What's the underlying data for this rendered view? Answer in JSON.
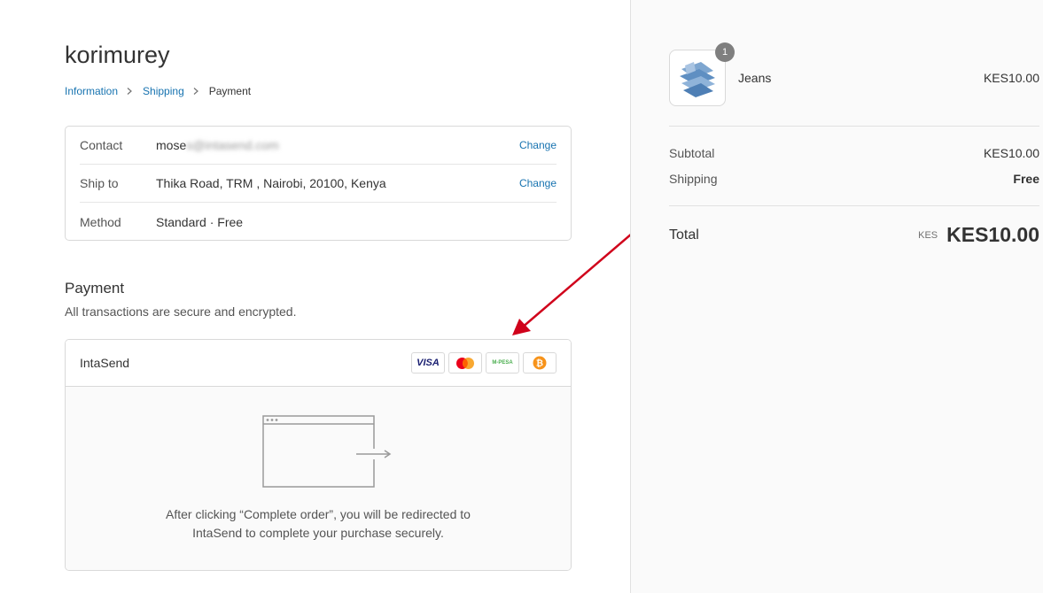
{
  "store": {
    "name": "korimurey"
  },
  "breadcrumb": {
    "information": "Information",
    "shipping": "Shipping",
    "payment": "Payment"
  },
  "review": {
    "contact": {
      "label": "Contact",
      "value_visible": "mose",
      "value_blurred": "s@intasend.com",
      "action": "Change"
    },
    "ship_to": {
      "label": "Ship to",
      "value": "Thika Road, TRM , Nairobi, 20100, Kenya",
      "action": "Change"
    },
    "method": {
      "label": "Method",
      "value": "Standard · Free"
    }
  },
  "payment": {
    "title": "Payment",
    "subtitle": "All transactions are secure and encrypted.",
    "gateway_name": "IntaSend",
    "card_icons": [
      "visa-icon",
      "mastercard-icon",
      "mpesa-icon",
      "bitcoin-icon"
    ],
    "visa_label": "VISA",
    "mpesa_label": "M-PESA",
    "redirect_line1": "After clicking “Complete order”, you will be redirected to",
    "redirect_line2": "IntaSend to complete your purchase securely."
  },
  "order": {
    "item": {
      "name": "Jeans",
      "price": "KES10.00",
      "quantity": "1"
    },
    "subtotal_label": "Subtotal",
    "subtotal_value": "KES10.00",
    "shipping_label": "Shipping",
    "shipping_value": "Free",
    "total_label": "Total",
    "total_currency": "KES",
    "total_value": "KES10.00"
  },
  "colors": {
    "link": "#1773b0",
    "annotation_arrow": "#d0021b",
    "sidebar_bg": "#fafafa"
  }
}
